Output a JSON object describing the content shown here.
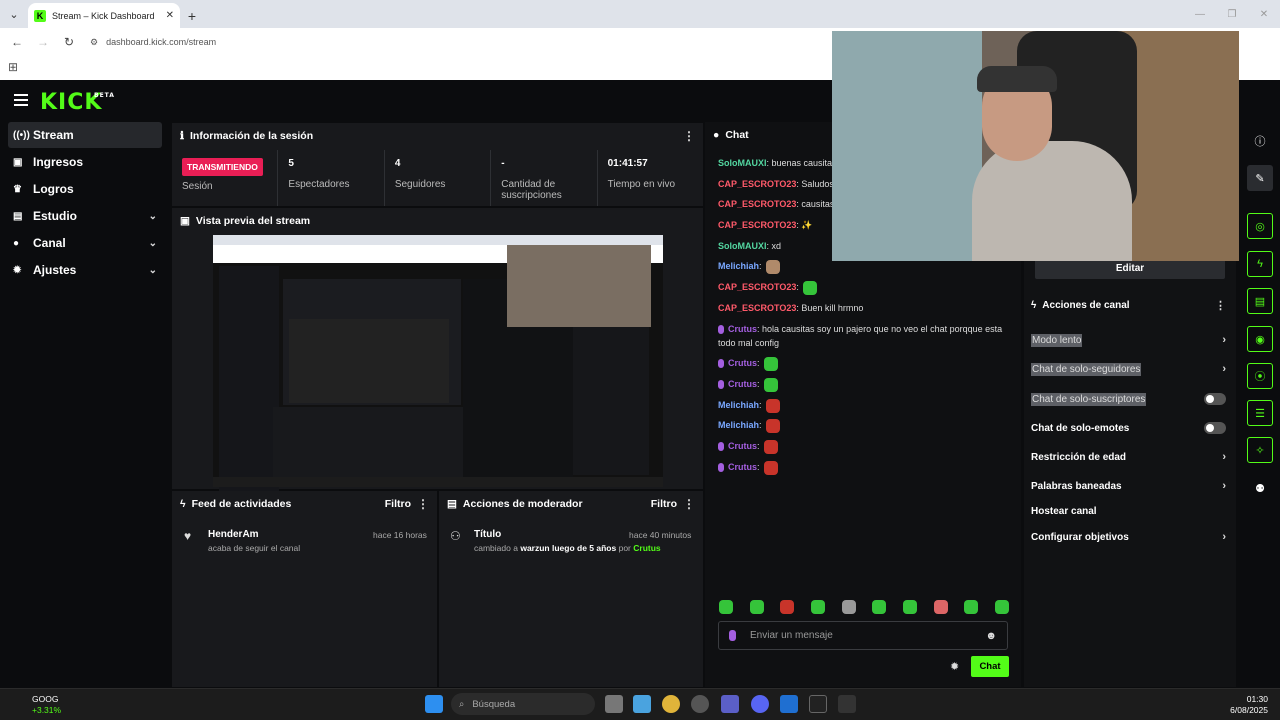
{
  "browser": {
    "tab_title": "Stream – Kick Dashboard",
    "url": "dashboard.kick.com/stream"
  },
  "brand": {
    "logo": "KICK",
    "badge": "BETA",
    "accent": "#53fc18"
  },
  "sidebar": {
    "items": [
      {
        "label": "Stream",
        "icon": "broadcast-icon",
        "active": true
      },
      {
        "label": "Ingresos",
        "icon": "money-icon"
      },
      {
        "label": "Logros",
        "icon": "trophy-icon"
      },
      {
        "label": "Estudio",
        "icon": "studio-icon",
        "expandable": true
      },
      {
        "label": "Canal",
        "icon": "channel-icon",
        "expandable": true
      },
      {
        "label": "Ajustes",
        "icon": "gear-icon",
        "expandable": true
      }
    ]
  },
  "session": {
    "title": "Información de la sesión",
    "badge": "TRANSMITIENDO",
    "badge_label": "Sesión",
    "stats": [
      {
        "value": "5",
        "label": "Espectadores"
      },
      {
        "value": "4",
        "label": "Seguidores"
      },
      {
        "value": "-",
        "label": "Cantidad de suscripciones"
      },
      {
        "value": "01:41:57",
        "label": "Tiempo en vivo"
      }
    ]
  },
  "preview": {
    "title": "Vista previa del stream"
  },
  "feed": {
    "title": "Feed de actividades",
    "filter": "Filtro",
    "items": [
      {
        "user": "HenderAm",
        "text": "acaba de seguir el canal",
        "time": "hace 16 horas"
      }
    ]
  },
  "mod": {
    "title": "Acciones de moderador",
    "filter": "Filtro",
    "items": [
      {
        "title": "Título",
        "pre": "cambiado a",
        "value": "warzun luego de 5 años",
        "by": "por",
        "user": "Crutus",
        "time": "hace 40 minutos"
      }
    ]
  },
  "chat": {
    "title": "Chat",
    "messages": [
      {
        "user": "SoloMAUXI",
        "color": "#53d6a0",
        "text": "buenas causitas"
      },
      {
        "user": "CAP_ESCROTO23",
        "color": "#ff5a6a",
        "text": "Saludos"
      },
      {
        "user": "CAP_ESCROTO23",
        "color": "#ff5a6a",
        "text": "causitas"
      },
      {
        "user": "CAP_ESCROTO23",
        "color": "#ff5a6a",
        "text": "✨"
      },
      {
        "user": "SoloMAUXI",
        "color": "#53d6a0",
        "text": "xd"
      },
      {
        "user": "Melichiah",
        "color": "#7aa8ff",
        "text": ""
      },
      {
        "user": "CAP_ESCROTO23",
        "color": "#ff5a6a",
        "text": ""
      },
      {
        "user": "CAP_ESCROTO23",
        "color": "#ff5a6a",
        "text": "Buen kill hrmno"
      },
      {
        "user": "Crutus",
        "color": "#a45fe0",
        "text": "hola causitas soy un pajero que no veo el chat porqque esta todo mal config"
      },
      {
        "user": "Crutus",
        "color": "#a45fe0",
        "text": ""
      },
      {
        "user": "Crutus",
        "color": "#a45fe0",
        "text": ""
      },
      {
        "user": "Melichiah",
        "color": "#7aa8ff",
        "text": ""
      },
      {
        "user": "Melichiah",
        "color": "#7aa8ff",
        "text": ""
      },
      {
        "user": "Crutus",
        "color": "#a45fe0",
        "text": ""
      },
      {
        "user": "Crutus",
        "color": "#a45fe0",
        "text": ""
      }
    ],
    "placeholder": "Enviar un mensaje",
    "send": "Chat"
  },
  "channel": {
    "edit": "Editar",
    "title": "Acciones de canal",
    "actions": [
      {
        "label": "Modo lento",
        "type": "chevron"
      },
      {
        "label": "Chat de solo-seguidores",
        "type": "chevron"
      },
      {
        "label": "Chat de solo-suscriptores",
        "type": "toggle"
      },
      {
        "label": "Chat de solo-emotes",
        "type": "toggle"
      },
      {
        "label": "Restricción de edad",
        "type": "chevron"
      },
      {
        "label": "Palabras baneadas",
        "type": "chevron"
      },
      {
        "label": "Hostear canal",
        "type": "none"
      },
      {
        "label": "Configurar objetivos",
        "type": "chevron"
      }
    ]
  },
  "taskbar": {
    "stock_name": "GOOG",
    "stock_change": "+3.31%",
    "search": "Búsqueda",
    "time": "01:30",
    "date": "6/08/2025"
  }
}
